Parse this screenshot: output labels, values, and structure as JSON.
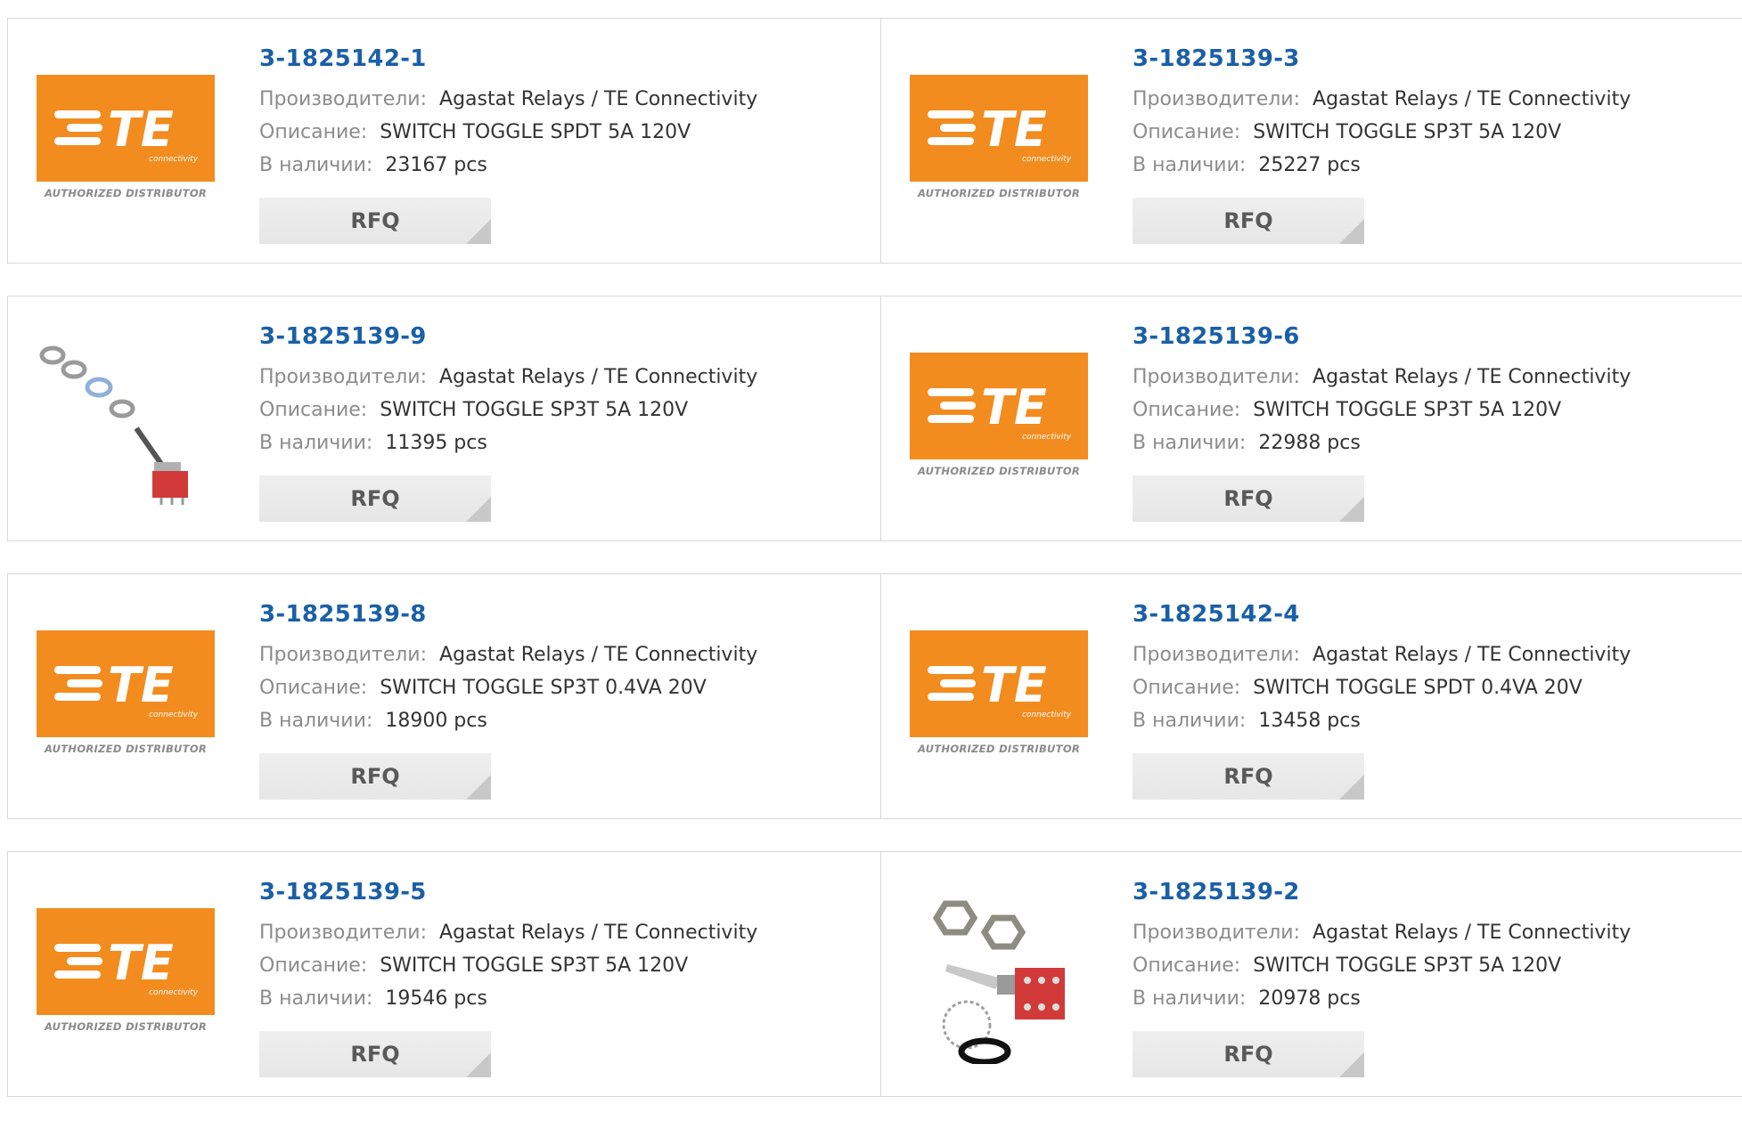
{
  "labels": {
    "manufacturer": "Производители:",
    "description": "Описание:",
    "stock": "В наличии:",
    "rfq": "RFQ",
    "logo_caption": "AUTHORIZED DISTRIBUTOR",
    "logo_sub": "connectivity",
    "logo_mark": "TE"
  },
  "colors": {
    "link": "#1a5fa8",
    "logo_orange": "#f28c1e"
  },
  "products": [
    {
      "part": "3-1825142-1",
      "manufacturer": "Agastat Relays / TE Connectivity",
      "description": "SWITCH TOGGLE SPDT 5A 120V",
      "stock": "23167 pcs",
      "image": "te-logo"
    },
    {
      "part": "3-1825139-3",
      "manufacturer": "Agastat Relays / TE Connectivity",
      "description": "SWITCH TOGGLE SP3T 5A 120V",
      "stock": "25227 pcs",
      "image": "te-logo"
    },
    {
      "part": "3-1825139-9",
      "manufacturer": "Agastat Relays / TE Connectivity",
      "description": "SWITCH TOGGLE SP3T 5A 120V",
      "stock": "11395 pcs",
      "image": "toggle-switch-photo-a"
    },
    {
      "part": "3-1825139-6",
      "manufacturer": "Agastat Relays / TE Connectivity",
      "description": "SWITCH TOGGLE SP3T 5A 120V",
      "stock": "22988 pcs",
      "image": "te-logo"
    },
    {
      "part": "3-1825139-8",
      "manufacturer": "Agastat Relays / TE Connectivity",
      "description": "SWITCH TOGGLE SP3T 0.4VA 20V",
      "stock": "18900 pcs",
      "image": "te-logo"
    },
    {
      "part": "3-1825142-4",
      "manufacturer": "Agastat Relays / TE Connectivity",
      "description": "SWITCH TOGGLE SPDT 0.4VA 20V",
      "stock": "13458 pcs",
      "image": "te-logo"
    },
    {
      "part": "3-1825139-5",
      "manufacturer": "Agastat Relays / TE Connectivity",
      "description": "SWITCH TOGGLE SP3T 5A 120V",
      "stock": "19546 pcs",
      "image": "te-logo"
    },
    {
      "part": "3-1825139-2",
      "manufacturer": "Agastat Relays / TE Connectivity",
      "description": "SWITCH TOGGLE SP3T 5A 120V",
      "stock": "20978 pcs",
      "image": "toggle-switch-photo-b"
    }
  ]
}
